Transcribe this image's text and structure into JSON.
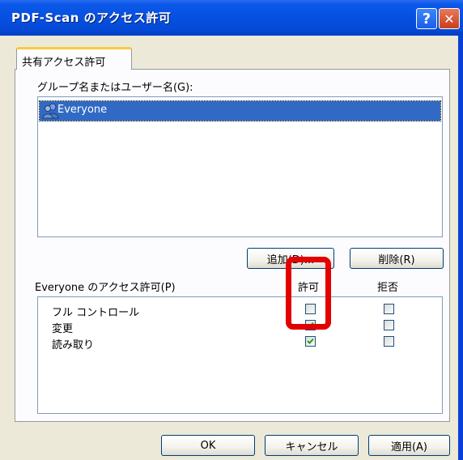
{
  "window": {
    "title": "PDF-Scan のアクセス許可",
    "help_glyph": "?",
    "close_glyph": "✕"
  },
  "tab": {
    "label": "共有アクセス許可"
  },
  "groups": {
    "label": "グループ名またはユーザー名(G):",
    "items": [
      {
        "name": "Everyone",
        "icon": "users-icon",
        "selected": true
      }
    ],
    "add_label": "追加(D)...",
    "remove_label": "削除(R)"
  },
  "permissions": {
    "label": "Everyone のアクセス許可(P)",
    "allow_header": "許可",
    "deny_header": "拒否",
    "rows": [
      {
        "label": "フル コントロール",
        "allow": false,
        "deny": false
      },
      {
        "label": "変更",
        "allow": true,
        "deny": false
      },
      {
        "label": "読み取り",
        "allow": true,
        "deny": false
      }
    ]
  },
  "footer": {
    "ok_label": "OK",
    "cancel_label": "キャンセル",
    "apply_label": "適用(A)"
  },
  "colors": {
    "titlebar": "#0550e0",
    "face": "#ece9d8",
    "selection": "#316ac5",
    "highlight": "#e20000"
  }
}
